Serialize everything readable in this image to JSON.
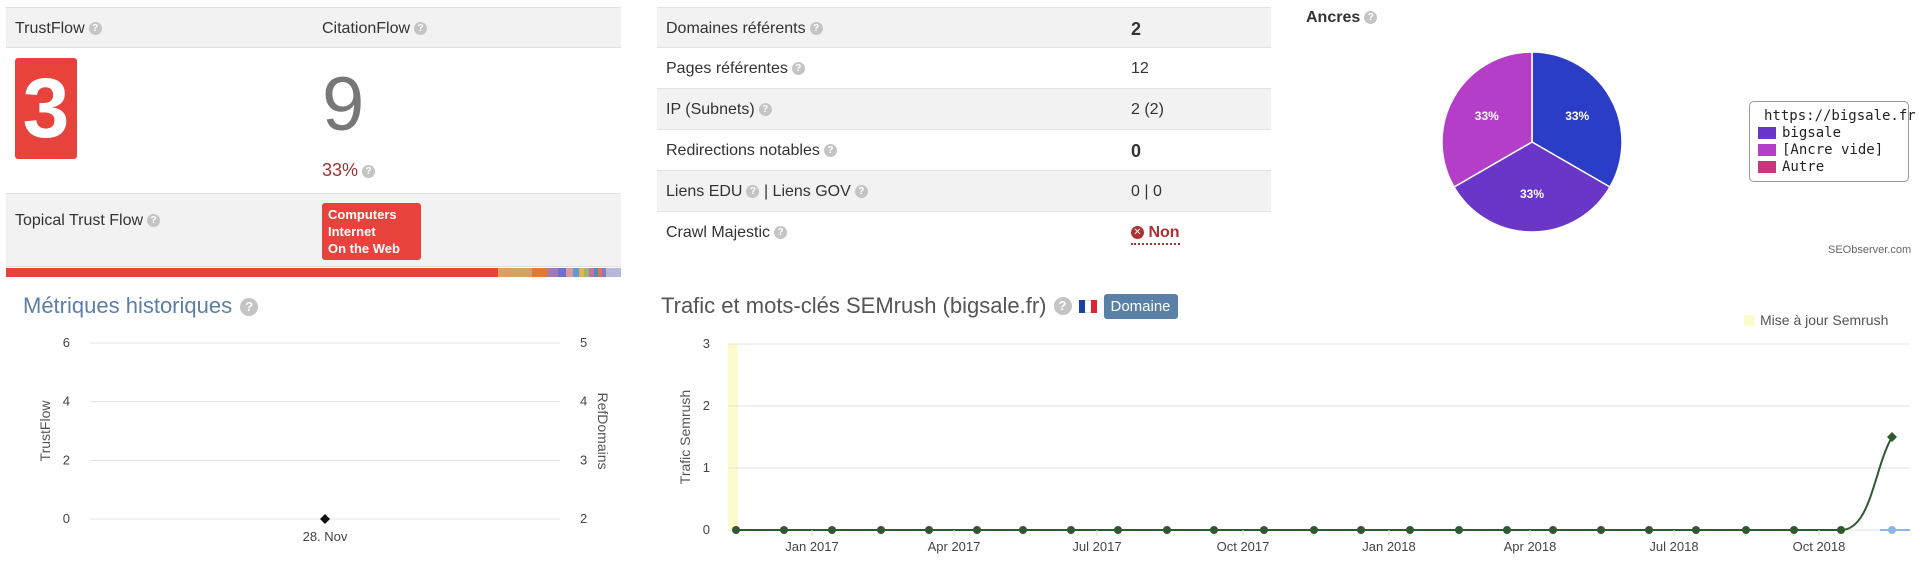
{
  "trustflow": {
    "tf_label": "TrustFlow",
    "cf_label": "CitationFlow",
    "tf_value": "3",
    "cf_value": "9",
    "ratio": "33%",
    "topical_label": "Topical Trust Flow",
    "topical_badge": [
      "Computers",
      "Internet",
      "On the Web"
    ],
    "tf_color": "#e8423c"
  },
  "ref_table": {
    "rows": [
      {
        "label": "Domaines référents",
        "value": "2",
        "bold": true
      },
      {
        "label": "Pages référentes",
        "value": "12",
        "bold": false
      },
      {
        "label": "IP (Subnets)",
        "value": "2 (2)",
        "bold": false
      },
      {
        "label": "Redirections notables",
        "value": "0",
        "bold": true
      },
      {
        "label": "Liens EDU",
        "label2": "| Liens GOV",
        "value": "0 | 0",
        "bold": false
      },
      {
        "label": "Crawl Majestic",
        "value": "Non",
        "bold": false
      }
    ]
  },
  "anchors": {
    "title": "Ancres",
    "credit": "SEObserver.com",
    "legend": [
      {
        "label": "https://bigsale.fr",
        "color": "#2b3cc6"
      },
      {
        "label": "bigsale",
        "color": "#6a36c8"
      },
      {
        "label": "[Ancre vide]",
        "color": "#b43ec8"
      },
      {
        "label": "Autre",
        "color": "#c8367e"
      }
    ]
  },
  "historic": {
    "title": "Métriques historiques",
    "left_axis_label": "TrustFlow",
    "right_axis_label": "RefDomains",
    "x_label": "28. Nov"
  },
  "semrush": {
    "title": "Trafic et mots-clés SEMrush (bigsale.fr)",
    "badge": "Domaine",
    "legend_update": "Mise à jour Semrush",
    "y_axis_label": "Trafic Semrush"
  },
  "chart_data": [
    {
      "type": "pie",
      "title": "Ancres",
      "categories": [
        "https://bigsale.fr",
        "bigsale",
        "[Ancre vide]",
        "Autre"
      ],
      "values": [
        33.3,
        33.3,
        33.3,
        0
      ],
      "labels": [
        "33%",
        "33%",
        "33%",
        ""
      ],
      "legend": "right"
    },
    {
      "type": "scatter",
      "title": "Métriques historiques",
      "ylabel": "TrustFlow",
      "y2label": "RefDomains",
      "ylim": [
        0,
        6
      ],
      "y2lim": [
        2,
        5
      ],
      "yticks": [
        0,
        2,
        4,
        6
      ],
      "y2ticks": [
        2,
        3,
        4,
        5
      ],
      "categories": [
        "28. Nov"
      ],
      "series": [
        {
          "values": [
            0
          ]
        }
      ],
      "grid": true
    },
    {
      "type": "line",
      "title": "Trafic et mots-clés SEMrush (bigsale.fr)",
      "ylabel": "Trafic Semrush",
      "ylim": [
        0,
        3
      ],
      "yticks": [
        0,
        1,
        2,
        3
      ],
      "xticks": [
        "Jan 2017",
        "Apr 2017",
        "Jul 2017",
        "Oct 2017",
        "Jan 2018",
        "Apr 2018",
        "Jul 2018",
        "Oct 2018"
      ],
      "x": [
        "2016-11",
        "2016-12",
        "2017-01",
        "2017-02",
        "2017-03",
        "2017-04",
        "2017-05",
        "2017-06",
        "2017-07",
        "2017-08",
        "2017-09",
        "2017-10",
        "2017-11",
        "2017-12",
        "2018-01",
        "2018-02",
        "2018-03",
        "2018-04",
        "2018-05",
        "2018-06",
        "2018-07",
        "2018-08",
        "2018-09",
        "2018-10",
        "2018-11",
        "2018-12"
      ],
      "series": [
        {
          "values": [
            0,
            0,
            0,
            0,
            0,
            0,
            0,
            0,
            0,
            0,
            0,
            0,
            0,
            0,
            0,
            0,
            0,
            0,
            0,
            0,
            0,
            0,
            0,
            0,
            1.5,
            0
          ],
          "color": "#2e5b2e"
        }
      ],
      "grid": true
    }
  ]
}
